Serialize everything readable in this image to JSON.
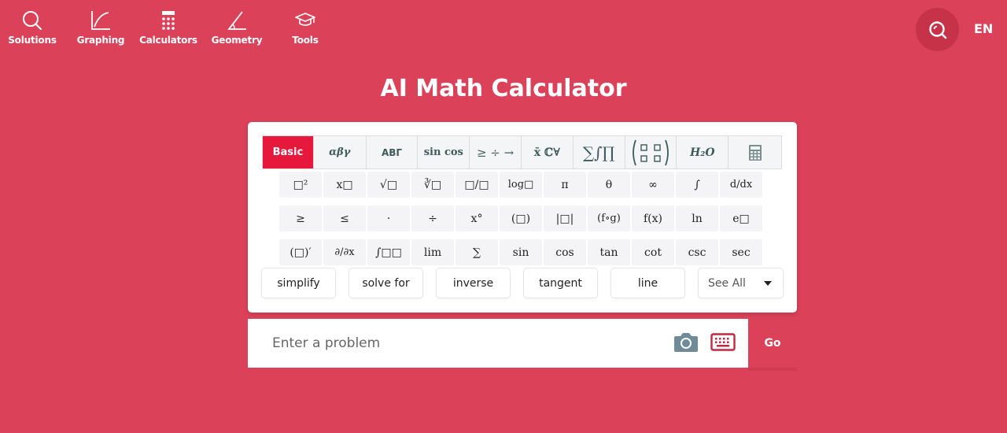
{
  "nav": {
    "items": [
      {
        "label": "Solutions",
        "icon": "search-icon"
      },
      {
        "label": "Graphing",
        "icon": "graph-icon"
      },
      {
        "label": "Calculators",
        "icon": "calculator-icon"
      },
      {
        "label": "Geometry",
        "icon": "angle-icon"
      },
      {
        "label": "Tools",
        "icon": "graduation-cap-icon"
      }
    ],
    "search_icon": "search-icon",
    "language": "EN"
  },
  "title": "AI Math Calculator",
  "keypad": {
    "tabs": [
      "Basic",
      "αβγ",
      "ΑΒΓ",
      "sin cos",
      "≥ ÷ →",
      "x̄ ℂ∀",
      "∑∫∏",
      "( ▫ ▫ )",
      "H₂O",
      "calculator-icon"
    ],
    "active_tab": "Basic",
    "rows": [
      [
        "□²",
        "x□",
        "√□",
        "∛□",
        "□/□",
        "log□",
        "π",
        "θ",
        "∞",
        "∫",
        "d/dx"
      ],
      [
        "≥",
        "≤",
        "·",
        "÷",
        "x°",
        "(□)",
        "|□|",
        "(f∘g)",
        "f(x)",
        "ln",
        "e□"
      ],
      [
        "(□)′",
        "∂/∂x",
        "∫□□",
        "lim",
        "∑",
        "sin",
        "cos",
        "tan",
        "cot",
        "csc",
        "sec"
      ]
    ],
    "operations": [
      "simplify",
      "solve for",
      "inverse",
      "tangent",
      "line"
    ],
    "see_all": "See All"
  },
  "input": {
    "placeholder": "Enter a problem",
    "value": "",
    "camera_icon": "camera-icon",
    "keyboard_icon": "keyboard-icon",
    "go_label": "Go"
  },
  "colors": {
    "background": "#db4159",
    "active_tab": "#e6183c",
    "search_button": "#c63349"
  }
}
